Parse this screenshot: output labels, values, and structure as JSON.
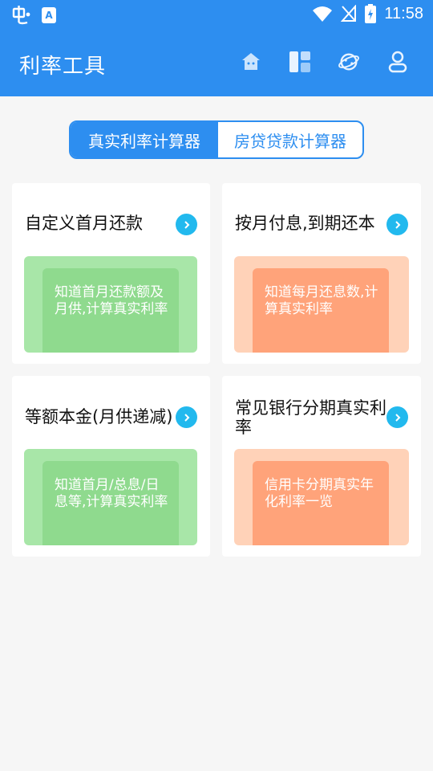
{
  "status_bar": {
    "app_icon_1": "chinese-char-icon",
    "app_icon_2_letter": "A",
    "time": "11:58",
    "icons": [
      "wifi-icon",
      "no-signal-icon",
      "battery-charging-icon"
    ]
  },
  "header": {
    "title": "利率工具",
    "icons": [
      "home-icon",
      "dashboard-icon",
      "planet-icon",
      "user-icon"
    ]
  },
  "tabs": [
    {
      "label": "真实利率计算器",
      "active": true
    },
    {
      "label": "房贷贷款计算器",
      "active": false
    }
  ],
  "cards": [
    {
      "title": "自定义首月还款",
      "description": "知道首月还款额及月供,计算真实利率",
      "color": "green"
    },
    {
      "title": "按月付息,到期还本",
      "description": "知道每月还息数,计算真实利率",
      "color": "orange"
    },
    {
      "title": "等额本金(月供递减)",
      "description": "知道首月/总息/日息等,计算真实利率",
      "color": "green"
    },
    {
      "title": "常见银行分期真实利率",
      "description": "信用卡分期真实年化利率一览",
      "color": "orange"
    }
  ],
  "colors": {
    "primary": "#2d8ef0",
    "arrow": "#22b9ee",
    "green_outer": "#a8e6a8",
    "green_inner": "#8fda8e",
    "orange_outer": "#ffd2b8",
    "orange_inner": "#ffa37a"
  }
}
